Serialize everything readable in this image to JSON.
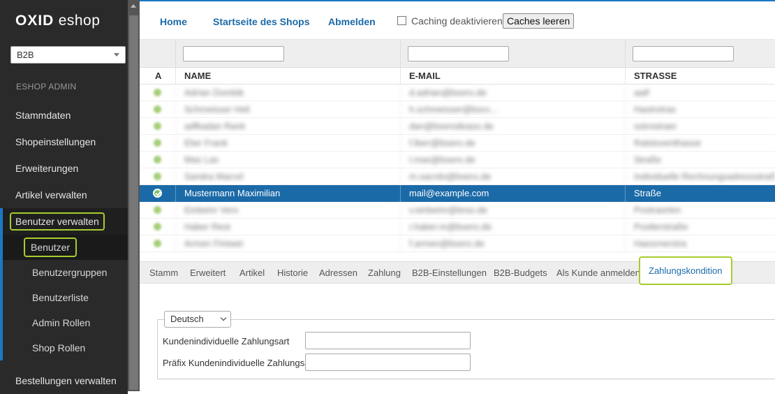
{
  "sidebar": {
    "logo_bold": "OXID",
    "logo_light": "eshop",
    "shop_select": "B2B",
    "section_label": "ESHOP ADMIN",
    "items": [
      {
        "label": "Stammdaten"
      },
      {
        "label": "Shopeinstellungen"
      },
      {
        "label": "Erweiterungen"
      },
      {
        "label": "Artikel verwalten"
      },
      {
        "label": "Benutzer verwalten"
      },
      {
        "label": "Bestellungen verwalten"
      }
    ],
    "subitems": [
      {
        "label": "Benutzer"
      },
      {
        "label": "Benutzergruppen"
      },
      {
        "label": "Benutzerliste"
      },
      {
        "label": "Admin Rollen"
      },
      {
        "label": "Shop Rollen"
      }
    ]
  },
  "topbar": {
    "home": "Home",
    "shop_start": "Startseite des Shops",
    "logout": "Abmelden",
    "caching_label": "Caching deaktivieren",
    "clear_caches": "Caches leeren"
  },
  "table": {
    "columns": [
      "A",
      "NAME",
      "E-MAIL",
      "STRASSE"
    ],
    "rows": [
      {
        "name": "Adrian Dombik",
        "email": "d.adrian@bsero.de",
        "street": "aatf"
      },
      {
        "name": "Schmeisser Heli",
        "email": "h.schmeisser@bsro...",
        "street": "Hastrotras"
      },
      {
        "name": "adfkadan Rank",
        "email": "dan@bserodeaso.de",
        "street": "sstrostraer"
      },
      {
        "name": "Elwr Frank",
        "email": "f.llwrr@bsero.de",
        "street": "Ralstoventhasse"
      },
      {
        "name": "Mas Las",
        "email": "l.mas@bsero.de",
        "street": "Straße"
      },
      {
        "name": "Sandra Marcel",
        "email": "m.sacrdo@bsero.de",
        "street": "Individuelle Rechnungsadressstraße"
      },
      {
        "name": "Mustermann Maximilian",
        "email": "mail@example.com",
        "street": "Straße",
        "selected": true
      },
      {
        "name": "Einbeinr Vers",
        "email": "v.einbeinr@brso.de",
        "street": "Postraorten"
      },
      {
        "name": "Haber Rest",
        "email": "r.haber.m@bsero.de",
        "street": "Postlerstraße"
      },
      {
        "name": "Armen Fintwet",
        "email": "f.armen@bsero.de",
        "street": "Haesrnerstra"
      }
    ]
  },
  "tabs": [
    {
      "label": "Stamm"
    },
    {
      "label": "Erweitert"
    },
    {
      "label": "Artikel"
    },
    {
      "label": "Historie"
    },
    {
      "label": "Adressen"
    },
    {
      "label": "Zahlung"
    },
    {
      "label": "B2B-Einstellungen"
    },
    {
      "label": "B2B-Budgets"
    },
    {
      "label": "Als Kunde anmelden"
    },
    {
      "label": "Zahlungskondition",
      "active": true
    }
  ],
  "detail": {
    "language": "Deutsch",
    "field1_label": "Kundenindividuelle Zahlungsart",
    "field1_value": "",
    "field2_label": "Präfix Kundenindividuelle Zahlungsart",
    "field2_value": ""
  },
  "colors": {
    "accent_blue": "#1b6aa8",
    "highlight_green": "#a7cc2f",
    "sidebar_bg": "#2a2a2a"
  }
}
